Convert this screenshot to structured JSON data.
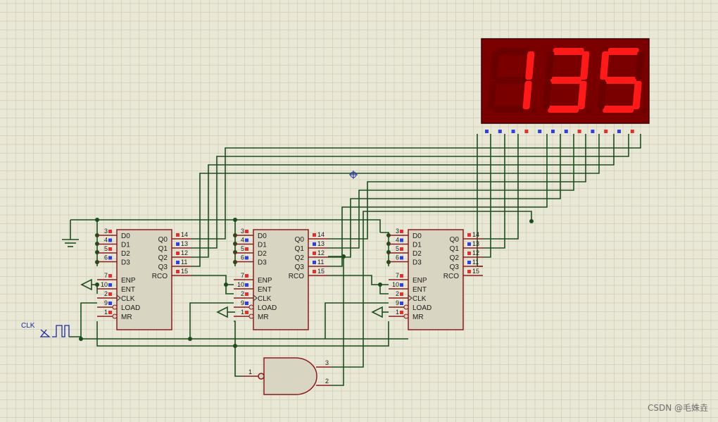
{
  "display": {
    "digits": [
      "1",
      "3",
      "5"
    ],
    "on_color": "#ff1a1a",
    "off_color": "#6a0000",
    "case_color": "#7a0000"
  },
  "counter": {
    "left_pins": [
      {
        "num": "3",
        "label": "D0"
      },
      {
        "num": "4",
        "label": "D1"
      },
      {
        "num": "5",
        "label": "D2"
      },
      {
        "num": "6",
        "label": "D3"
      },
      {
        "num": "7",
        "label": "ENP"
      },
      {
        "num": "10",
        "label": "ENT"
      },
      {
        "num": "2",
        "label": "CLK"
      },
      {
        "num": "9",
        "label": "LOAD"
      },
      {
        "num": "1",
        "label": "MR"
      }
    ],
    "right_pins": [
      {
        "num": "14",
        "label": "Q0"
      },
      {
        "num": "13",
        "label": "Q1"
      },
      {
        "num": "12",
        "label": "Q2"
      },
      {
        "num": "11",
        "label": "Q3"
      },
      {
        "num": "15",
        "label": "RCO"
      }
    ]
  },
  "clock": {
    "label": "CLK"
  },
  "nand_gate": {
    "pins": [
      "1",
      "3",
      "2"
    ]
  },
  "watermark": "CSDN @毛姝垚",
  "colors": {
    "wire": "#1d4d1d",
    "chip_border": "#8b1a1a",
    "chip_fill": "#d8d6c2",
    "pin_label": "#1a1a1a",
    "grid": "#cfcdb8"
  }
}
